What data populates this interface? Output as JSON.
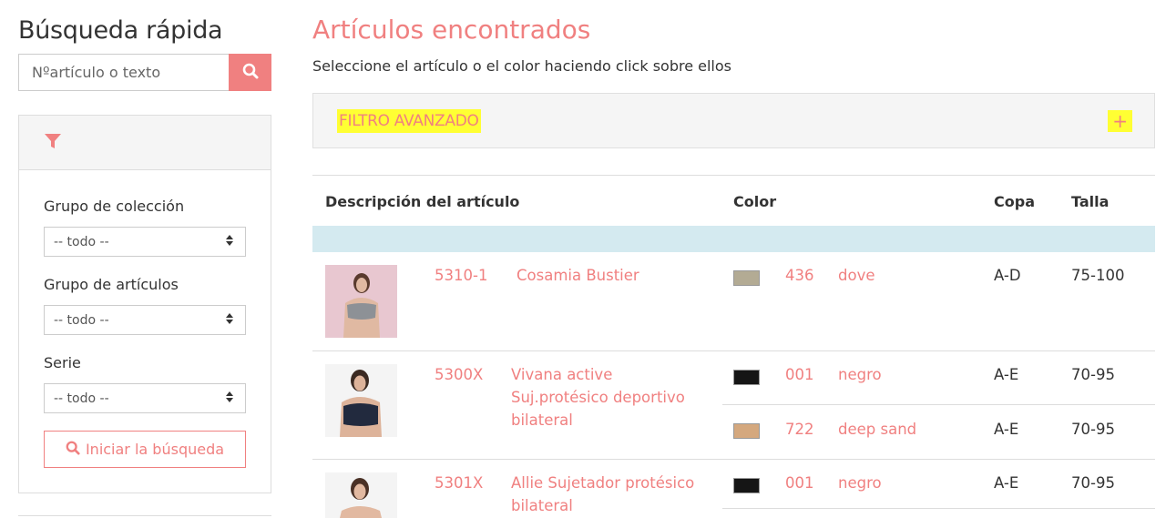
{
  "sidebar": {
    "title": "Búsqueda rápida",
    "search_placeholder": "Nºartículo o texto",
    "filters": [
      {
        "label": "Grupo de colección",
        "value": "-- todo --"
      },
      {
        "label": "Grupo de artículos",
        "value": "-- todo --"
      },
      {
        "label": "Serie",
        "value": "-- todo --"
      }
    ],
    "start_button": "Iniciar la búsqueda"
  },
  "main": {
    "title": "Artículos encontrados",
    "subtitle": "Seleccione el artículo o el color haciendo click sobre ellos",
    "advanced_filter": "FILTRO AVANZADO",
    "advanced_toggle": "+",
    "columns": {
      "description": "Descripción del artículo",
      "color": "Color",
      "cup": "Copa",
      "size": "Talla"
    },
    "rows": [
      {
        "number": "5310-1",
        "name_lines": [
          "Cosamia Bustier"
        ],
        "colors": [
          {
            "swatch": "#b3ab94",
            "code": "436",
            "name": "dove",
            "cup": "A-D",
            "size": "75-100"
          }
        ]
      },
      {
        "number": "5300X",
        "name_lines": [
          "Vivana active",
          "Suj.protésico deportivo",
          "bilateral"
        ],
        "colors": [
          {
            "swatch": "#151515",
            "code": "001",
            "name": "negro",
            "cup": "A-E",
            "size": "70-95"
          },
          {
            "swatch": "#d4a87e",
            "code": "722",
            "name": "deep sand",
            "cup": "A-E",
            "size": "70-95"
          }
        ]
      },
      {
        "number": "5301X",
        "name_lines": [
          "Allie Sujetador protésico",
          "bilateral"
        ],
        "colors": [
          {
            "swatch": "#151515",
            "code": "001",
            "name": "negro",
            "cup": "A-E",
            "size": "70-95"
          }
        ]
      }
    ]
  },
  "colors": {
    "accent": "#f08080",
    "highlight": "#ffff33",
    "band": "#d4eaf0"
  }
}
